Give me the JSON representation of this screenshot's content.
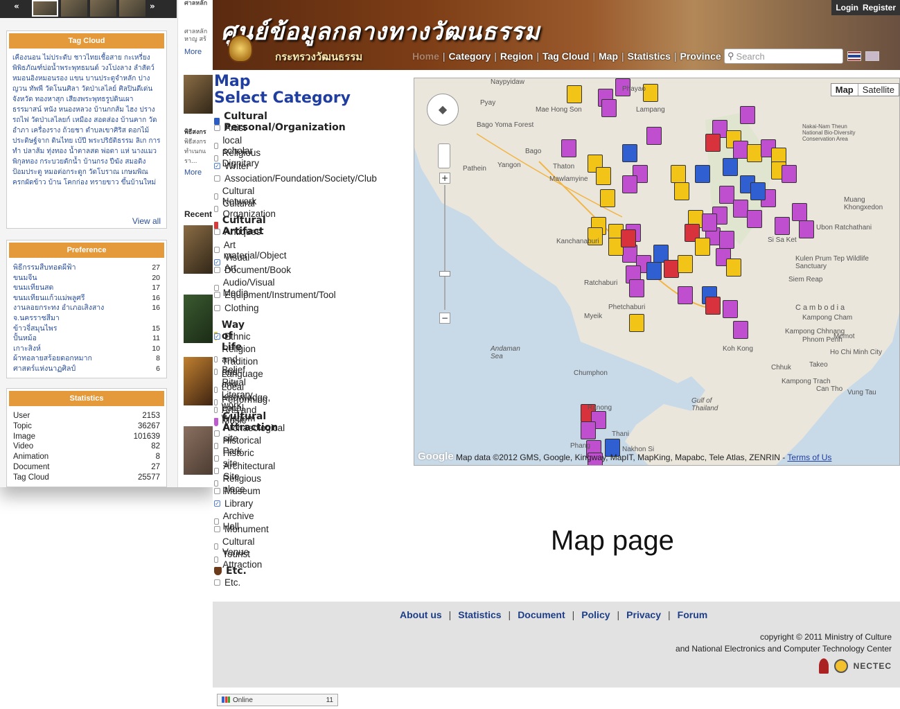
{
  "window_title": "Map",
  "site": {
    "title_thai": "ศูนย์ข้อมูลกลางทางวัฒนธรรม",
    "subtitle_thai": "กระทรวงวัฒนธรรม",
    "login": "Login",
    "register": "Register"
  },
  "nav": {
    "items": [
      "Home",
      "Category",
      "Region",
      "Tag Cloud",
      "Map",
      "Statistics",
      "Province"
    ],
    "search_placeholder": "Search"
  },
  "main": {
    "heading_line1": "Map",
    "heading_line2": "Select Category",
    "categories": [
      {
        "name": "Cultural Personal/Organization",
        "color": "#2b5cc6",
        "items": [
          {
            "label": "Artist",
            "checked": false
          },
          {
            "label": "local scholar",
            "checked": false
          },
          {
            "label": "Religious Dignitary",
            "checked": false
          },
          {
            "label": "Writer",
            "checked": true
          },
          {
            "label": "Association/Foundation/Society/Club",
            "checked": false
          },
          {
            "label": "Cultural Network",
            "checked": false
          },
          {
            "label": "Cultural Organization",
            "checked": false
          }
        ]
      },
      {
        "name": "Cultural Artifact",
        "color": "#d93a3a",
        "items": [
          {
            "label": "Antiques",
            "checked": false
          },
          {
            "label": "Art material/Object",
            "checked": false
          },
          {
            "label": "Visual Art",
            "checked": true
          },
          {
            "label": "Document/Book",
            "checked": false
          },
          {
            "label": "Audio/Visual Media",
            "checked": false
          },
          {
            "label": "Equipment/Instrument/Tool",
            "checked": false
          },
          {
            "label": "Clothing",
            "checked": false
          }
        ]
      },
      {
        "name": "Way of Life",
        "color": "#e6c21b",
        "items": [
          {
            "label": "Ethnic",
            "checked": true
          },
          {
            "label": "Religion and Belief",
            "checked": false
          },
          {
            "label": "Tradition and Ritual",
            "checked": false
          },
          {
            "label": "Language and Literary work",
            "checked": false
          },
          {
            "label": "Local Knowledge, Local Wisdom",
            "checked": false
          },
          {
            "label": "Performing Arts and Music",
            "checked": false
          }
        ]
      },
      {
        "name": "Cultural Attraction",
        "color": "#c05ad0",
        "items": [
          {
            "label": "Archaeological site",
            "checked": false
          },
          {
            "label": "Historical Park.",
            "checked": false
          },
          {
            "label": "Historic site",
            "checked": false
          },
          {
            "label": "Architectural Site",
            "checked": false
          },
          {
            "label": "Religious place",
            "checked": false
          },
          {
            "label": "Museum",
            "checked": false
          },
          {
            "label": "Library",
            "checked": true
          },
          {
            "label": "Archive Hall",
            "checked": false
          },
          {
            "label": "Monument",
            "checked": false
          },
          {
            "label": "Cultural Venue",
            "checked": false
          },
          {
            "label": "Tourist Attraction",
            "checked": false
          }
        ]
      },
      {
        "name": "Etc.",
        "color": "#6b3a1a",
        "items": [
          {
            "label": "Etc.",
            "checked": false
          }
        ]
      }
    ]
  },
  "map": {
    "btn_map": "Map",
    "btn_satellite": "Satellite",
    "attribution": "Map data ©2012 GMS, Google, Kingway, MapIT, MapKing, Mapabc, Tele Atlas, ZENRIN - ",
    "terms": "Terms of Us",
    "google": "Google",
    "labels": [
      "Naypyidaw",
      "Phayao",
      "Lampang",
      "Mae Hong Son",
      "Yangon",
      "Bago",
      "Pathein",
      "Thaton",
      "Bago Yoma Forest",
      "Mawlamyine",
      "Kanchanaburi",
      "Ratchaburi",
      "Phetchaburi",
      "Chumphon",
      "Ranong",
      "Phang",
      "Nakhon Si",
      "Gulf of Thailand",
      "Cambodia",
      "Phnom Penh",
      "Ho Chi Minh City",
      "Siem Reap",
      "Si Sa Ket",
      "Ubon Ratchathani",
      "Andaman Sea",
      "Koh Kong",
      "Kampong Chhnang",
      "Kampong Cham",
      "Can Tho",
      "Vung Tau",
      "Nakai-Nam Theun National Bio-Diversity Conservation Area",
      "Kulen Prum Tep Wildlife Sanctuary",
      "Muang Khongxedon",
      "Myeik",
      "Takeo",
      "Kampong Trach",
      "Memot",
      "Chhuk",
      "Pyay",
      "Thani"
    ]
  },
  "caption": "Map page",
  "footer": {
    "links": [
      "About us",
      "Statistics",
      "Document",
      "Policy",
      "Privacy",
      "Forum"
    ],
    "copyright1": "copyright © 2011 Ministry of Culture",
    "copyright2": "and National Electronics and Computer Technology Center",
    "nectec": "NECTEC",
    "online_label": "Online",
    "online_count": "11"
  },
  "background_page": {
    "tag_cloud_title": "Tag Cloud",
    "tag_cloud_text": "เคืองนอน ไม่ประดับ ชาวไทยเชื้อสาย กะเหรี่ยง พิพิธภัณฑ์บ่อน้ำพระพุทธมนต์ วงโปงลาง ลำสัตว์ หมอนอิงหมอนรอง แขน บานประตูจำหลัก ปางญวน ทัพพี วัดโนนศิลา วัดป่าเลไลย์ ศิลปินดีเด่น จังหวัด ทองหาสุก เสียงพระพุทธรูปดินเผา ธรรมาสน์ หนัง หนองหลวง บ้านกกส้ม ไฮง ปราง รถไฟ วัดป่าเลไลยก์ เหมือง สอดส่อง บ้านคาก วัดอำภา เครื่องราง ถ้วยชา ตำบลเขาศิริส ดอกไม้ประดิษฐ์จาก ดินไทย เบ้ปี พระปริยัติธรรม ลิเก การทำ ปลาส้ม ทุ่งทอง น้ำตาลสด พ่อตา แห่ นางแมว พิกุลทอง กระบวยตักน้ำ บ้านกรง ปีฆัง สมอดิง ป้อมประตู หมอต่อกระดูก วัดโบราณ เกษมพิณ ครกผัดข้าว บ้าน โคกก่อง ทรายขาว ขึ้นบ้านใหม่",
    "view_all": "View all",
    "preference_title": "Preference",
    "preference": [
      {
        "label": "พิธีกรรมสืบทอดผีฟ้า",
        "count": "27"
      },
      {
        "label": "ขนมจีน",
        "count": "20"
      },
      {
        "label": "ขนมเทียนสด",
        "count": "17"
      },
      {
        "label": "ขนมเทียนแก้วแม่พลูศรี",
        "count": "16"
      },
      {
        "label": "งานลอยกระทง อำเภอเสิงสาง",
        "count": "16"
      },
      {
        "label": "จ.นครราชสีมา",
        "count": ""
      },
      {
        "label": "ข้าวจี่สมุนไพร",
        "count": "15"
      },
      {
        "label": "ปั้นหม้อ",
        "count": "11"
      },
      {
        "label": "เกาะสิงห์",
        "count": "10"
      },
      {
        "label": "ผ้าทอลายสร้อยดอกหมาก",
        "count": "8"
      },
      {
        "label": "ศาสตร์แห่งนาฏศิลป์",
        "count": "6"
      }
    ],
    "statistics_title": "Statistics",
    "statistics": [
      {
        "label": "User",
        "count": "2153"
      },
      {
        "label": "Topic",
        "count": "36267"
      },
      {
        "label": "Image",
        "count": "101639"
      },
      {
        "label": "Video",
        "count": "82"
      },
      {
        "label": "Animation",
        "count": "8"
      },
      {
        "label": "Document",
        "count": "27"
      },
      {
        "label": "Tag Cloud",
        "count": "25577"
      }
    ],
    "mid_texts": [
      "ศาลหลัก",
      "ศาลหลัก",
      "หาญ สร้",
      "More",
      "พิธีสงกร",
      "พิธีสงกร",
      "ทำเนกแ",
      "รา...",
      "More",
      "Recent"
    ]
  }
}
